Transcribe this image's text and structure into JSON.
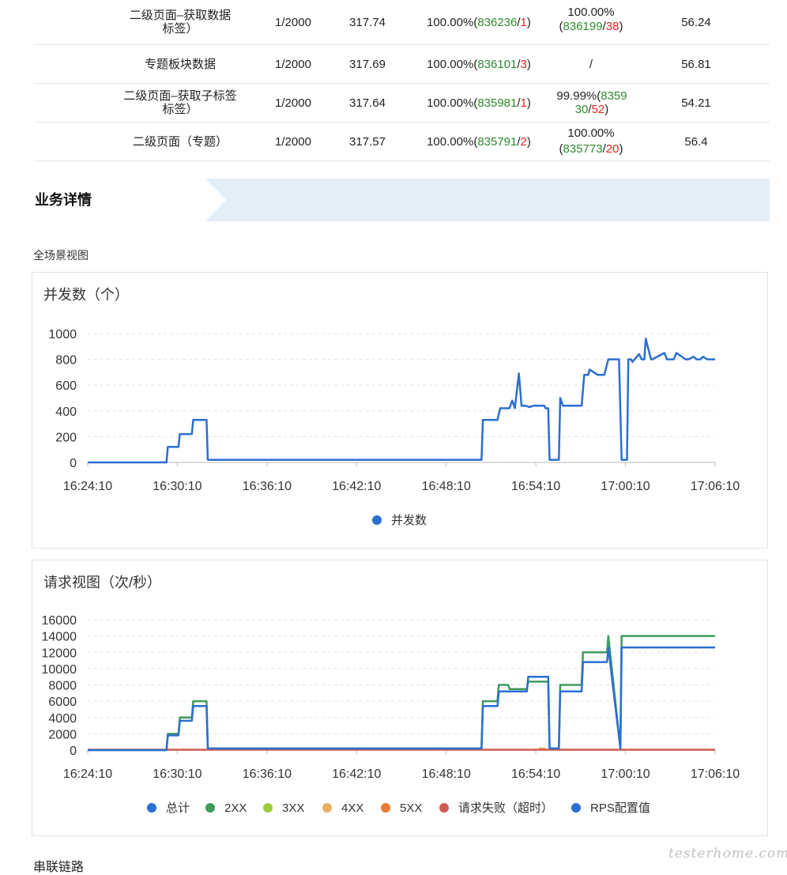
{
  "table": {
    "rows": [
      {
        "name": "二级页面–获取数据标签）",
        "conc": "1/2000",
        "rt": "317.74",
        "s1_pct": "100.00%",
        "s1_ok": "836236",
        "s1_bad": "1",
        "s2_pct": "100.00%",
        "s2_ok": "836199",
        "s2_bad": "38",
        "last": "56.24"
      },
      {
        "name": "专题板块数据",
        "conc": "1/2000",
        "rt": "317.69",
        "s1_pct": "100.00%",
        "s1_ok": "836101",
        "s1_bad": "3",
        "s2_text": "/",
        "last": "56.81"
      },
      {
        "name": "二级页面–获取子标签标签）",
        "conc": "1/2000",
        "rt": "317.64",
        "s1_pct": "100.00%",
        "s1_ok": "835981",
        "s1_bad": "1",
        "s2_pct": "99.99%",
        "s2_ok": "835930",
        "s2_bad": "52",
        "last": "54.21"
      },
      {
        "name": "二级页面（专题）",
        "conc": "1/2000",
        "rt": "317.57",
        "s1_pct": "100.00%",
        "s1_ok": "835791",
        "s1_bad": "2",
        "s2_pct": "100.00%",
        "s2_ok": "835773",
        "s2_bad": "20",
        "last": "56.4"
      }
    ]
  },
  "section": {
    "title": "业务详情",
    "overview_label": "全场景视图",
    "chain_label": "串联链路"
  },
  "watermark": "testerhome.com",
  "colors": {
    "accent_blue": "#2b6fd0",
    "green": "#3e9b5c",
    "lime": "#9ccd3a",
    "yellow": "#e8b060",
    "orange": "#ec7a34",
    "red": "#cf5a4f",
    "ok_text": "#2e8b2e",
    "bad_text": "#e0271d"
  },
  "chart_data": [
    {
      "type": "line",
      "title": "并发数（个）",
      "x_ticks": [
        "16:24:10",
        "16:30:10",
        "16:36:10",
        "16:42:10",
        "16:48:10",
        "16:54:10",
        "17:00:10",
        "17:06:10"
      ],
      "ylim": [
        0,
        1000
      ],
      "y_ticks": [
        "0",
        "200",
        "400",
        "600",
        "800",
        "1000"
      ],
      "grid": true,
      "legend": "bottom",
      "series": [
        {
          "name": "并发数",
          "color": "#2b6fd0",
          "x": [
            0,
            5.9,
            6.0,
            6.8,
            6.9,
            7.8,
            7.9,
            8.9,
            9.0,
            29.5,
            29.6,
            30.7,
            30.9,
            31.6,
            31.8,
            32.0,
            32.3,
            32.5,
            32.8,
            33.1,
            33.4,
            34.2,
            34.3,
            34.5,
            34.6,
            35.3,
            35.4,
            35.6,
            35.9,
            36.0,
            37.0,
            37.2,
            37.5,
            37.6,
            38.2,
            38.4,
            38.7,
            39.0,
            39.8,
            40.0,
            40.4,
            40.5,
            40.7,
            40.8,
            41.3,
            41.5,
            41.7,
            41.8,
            42.2,
            42.3,
            43.2,
            43.4,
            43.9,
            44.1,
            44.8,
            45.0,
            45.4,
            45.6,
            45.9,
            46.1,
            46.4,
            46.6,
            47.0
          ],
          "y": [
            0,
            0,
            120,
            120,
            220,
            220,
            330,
            330,
            20,
            20,
            330,
            330,
            420,
            420,
            480,
            420,
            690,
            440,
            440,
            430,
            440,
            440,
            420,
            420,
            20,
            20,
            500,
            440,
            440,
            440,
            440,
            680,
            680,
            720,
            680,
            680,
            680,
            800,
            800,
            20,
            20,
            800,
            800,
            780,
            840,
            800,
            800,
            960,
            800,
            800,
            850,
            800,
            800,
            850,
            800,
            800,
            820,
            800,
            800,
            820,
            800,
            800,
            800
          ]
        }
      ]
    },
    {
      "type": "line",
      "title": "请求视图（次/秒）",
      "x_ticks": [
        "16:24:10",
        "16:30:10",
        "16:36:10",
        "16:42:10",
        "16:48:10",
        "16:54:10",
        "17:00:10",
        "17:06:10"
      ],
      "ylim": [
        0,
        16000
      ],
      "y_ticks": [
        "0",
        "2000",
        "4000",
        "6000",
        "8000",
        "10000",
        "12000",
        "14000",
        "16000"
      ],
      "grid": true,
      "legend": "bottom",
      "series": [
        {
          "name": "总计",
          "color": "#2b6fd0",
          "x": [],
          "y": []
        },
        {
          "name": "2XX",
          "color": "#3e9b5c",
          "x": [
            0,
            5.9,
            6.0,
            6.8,
            6.9,
            7.8,
            7.9,
            8.9,
            9.0,
            29.5,
            29.6,
            30.7,
            30.8,
            31.5,
            31.6,
            32.9,
            33.0,
            34.5,
            34.6,
            35.3,
            35.4,
            37.0,
            37.1,
            38.9,
            39.0,
            39.9,
            40.0,
            47.0
          ],
          "y": [
            0,
            0,
            2000,
            2000,
            4000,
            4000,
            6000,
            6000,
            200,
            200,
            6000,
            6000,
            8000,
            8000,
            7500,
            7500,
            8400,
            8400,
            200,
            200,
            8000,
            8000,
            12000,
            12000,
            14000,
            200,
            14000,
            14000
          ]
        },
        {
          "name": "3XX",
          "color": "#9ccd3a",
          "x": [],
          "y": []
        },
        {
          "name": "4XX",
          "color": "#e8b060",
          "x": [
            33.8,
            34.3
          ],
          "y": [
            200,
            200
          ]
        },
        {
          "name": "5XX",
          "color": "#ec7a34",
          "x": [],
          "y": []
        },
        {
          "name": "请求失败（超时）",
          "color": "#cf5a4f",
          "x": [
            0,
            47.0
          ],
          "y": [
            50,
            50
          ]
        },
        {
          "name": "RPS配置值",
          "color": "#2b6fd0",
          "x": [
            0,
            5.9,
            6.0,
            6.8,
            6.9,
            7.8,
            7.9,
            8.9,
            9.0,
            29.5,
            29.6,
            30.7,
            30.8,
            32.9,
            33.0,
            34.5,
            34.6,
            35.3,
            35.4,
            37.0,
            37.1,
            38.9,
            39.0,
            39.9,
            40.0,
            47.0
          ],
          "y": [
            0,
            0,
            1800,
            1800,
            3600,
            3600,
            5400,
            5400,
            200,
            200,
            5400,
            5400,
            7200,
            7200,
            9000,
            9000,
            200,
            200,
            7200,
            7200,
            10800,
            10800,
            12600,
            200,
            12600,
            12600
          ]
        }
      ]
    }
  ]
}
